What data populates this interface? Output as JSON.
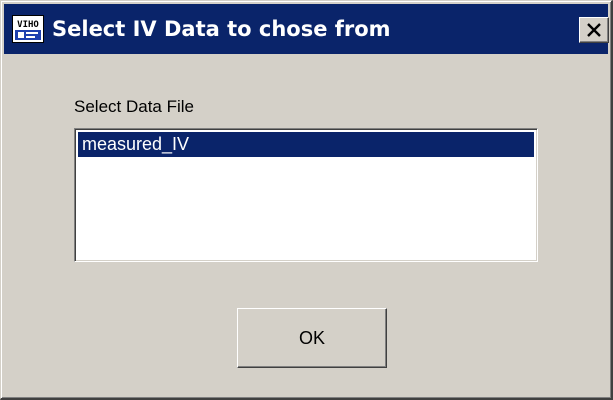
{
  "window": {
    "title": "Select IV Data to chose from",
    "icon": "app-icon",
    "close_label": "close",
    "colors": {
      "titlebar": "#0a246a",
      "title_text": "#ffffff",
      "face": "#d4d0c8",
      "selection": "#0a246a"
    }
  },
  "list": {
    "label": "Select Data File",
    "items": [
      {
        "label": "measured_IV",
        "selected": true
      }
    ]
  },
  "buttons": {
    "ok_label": "OK"
  }
}
